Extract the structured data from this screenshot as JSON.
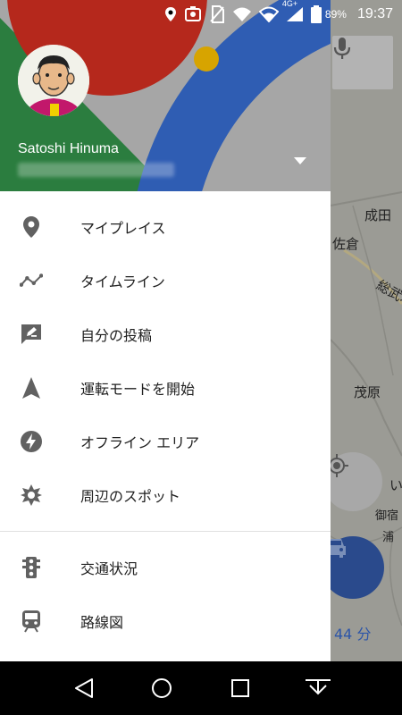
{
  "status_bar": {
    "battery_percent": "89%",
    "time": "19:37",
    "network": "4G+"
  },
  "account": {
    "name": "Satoshi Hinuma"
  },
  "menu": {
    "items": [
      {
        "label": "マイプレイス",
        "icon": "place-pin-icon"
      },
      {
        "label": "タイムライン",
        "icon": "timeline-icon"
      },
      {
        "label": "自分の投稿",
        "icon": "contributions-icon"
      },
      {
        "label": "運転モードを開始",
        "icon": "navigation-arrow-icon"
      },
      {
        "label": "オフライン エリア",
        "icon": "offline-bolt-icon"
      },
      {
        "label": "周辺のスポット",
        "icon": "explore-nearby-icon"
      }
    ],
    "layers": [
      {
        "label": "交通状況",
        "icon": "traffic-light-icon"
      },
      {
        "label": "路線図",
        "icon": "transit-train-icon"
      }
    ]
  },
  "map": {
    "labels": [
      "成田",
      "佐倉",
      "総武本",
      "茂原",
      "い",
      "御宿",
      "浦"
    ],
    "eta": "44 分"
  },
  "colors": {
    "header_red": "#b5281c",
    "header_green": "#2b7d3f",
    "header_blue": "#2f5db3",
    "header_yellow": "#d7a400"
  }
}
